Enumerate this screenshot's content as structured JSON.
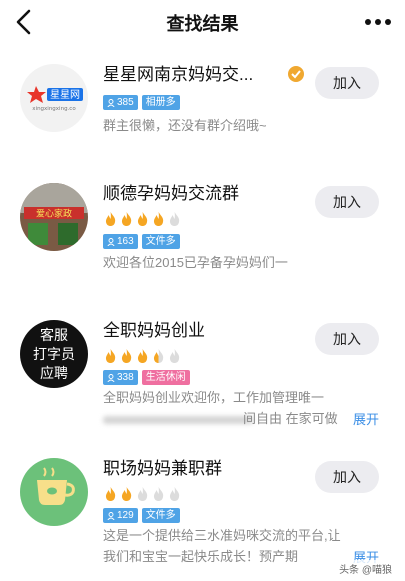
{
  "header": {
    "title": "查找结果"
  },
  "groups": [
    {
      "name": "星星网南京妈妈交...",
      "avatar_text": "星星网",
      "avatar_subtext": "xingxingxing.co",
      "members": "385",
      "tags": [
        "相册多"
      ],
      "description": "群主很懒，还没有群介绍哦~",
      "join_label": "加入",
      "verified": true
    },
    {
      "name": "顺德孕妈妈交流群",
      "avatar_text": "爱心家政",
      "flames": 4,
      "members": "163",
      "tags": [
        "文件多"
      ],
      "description": "欢迎各位2015已孕备孕妈妈们一",
      "join_label": "加入"
    },
    {
      "name": "全职妈妈创业",
      "avatar_lines": [
        "客服",
        "打字员",
        "应聘"
      ],
      "flames": 3.5,
      "members": "338",
      "tags": [
        "生活休闲"
      ],
      "description_lines": [
        "全职妈妈创业欢迎你，工作加管理唯一",
        "间自由 在家可做"
      ],
      "expand_label": "展开",
      "join_label": "加入"
    },
    {
      "name": "职场妈妈兼职群",
      "flames": 2,
      "members": "129",
      "tags": [
        "文件多"
      ],
      "description_lines": [
        "这是一个提供给三水准妈咪交流的平台,让",
        "我们和宝宝一起快乐成长！预产期"
      ],
      "expand_label": "展开",
      "join_label": "加入"
    }
  ],
  "watermark": "头条 @喵狼",
  "colors": {
    "accent": "#3a8ee6",
    "tag_blue": "#4fa3e6",
    "tag_pink": "#ef6fa0",
    "flame": "#f5a623",
    "flame_off": "#dcdcdc"
  }
}
